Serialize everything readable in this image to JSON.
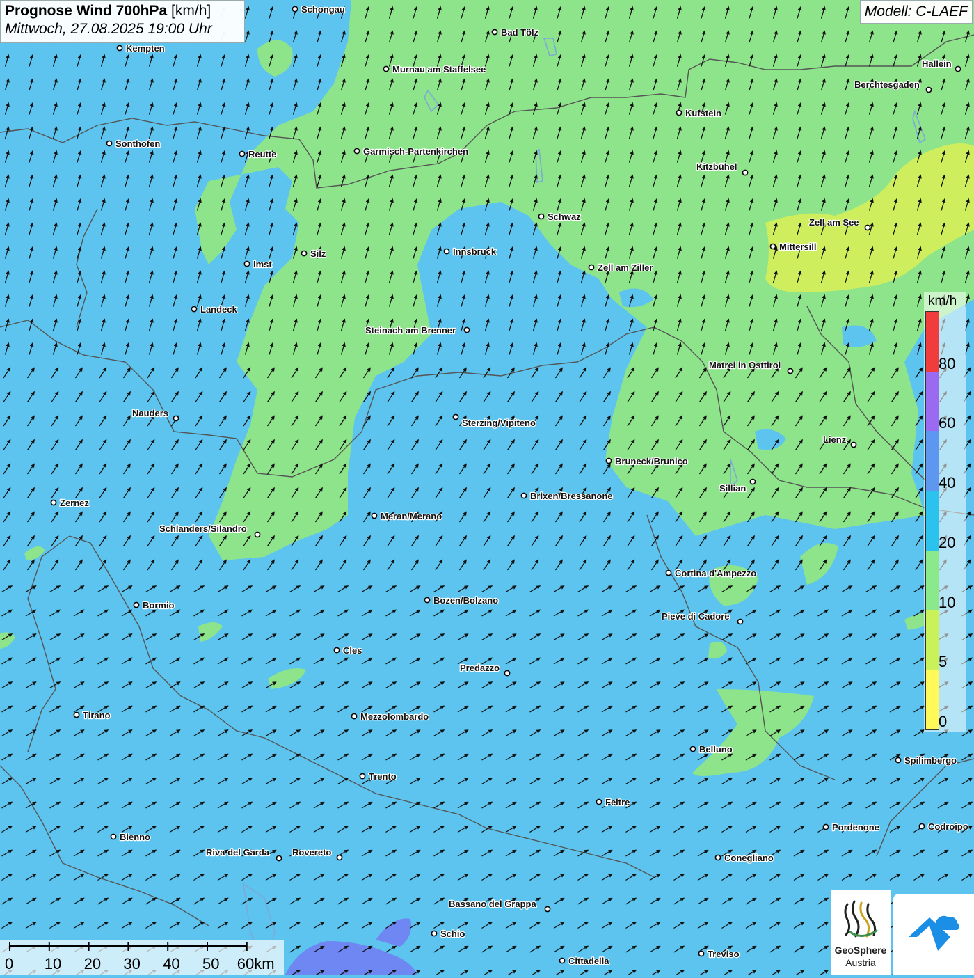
{
  "header": {
    "title_bold": "Prognose Wind 700hPa",
    "title_unit": " [km/h]",
    "datetime": "Mittwoch, 27.08.2025 19:00 Uhr",
    "model": "Modell: C-LAEF"
  },
  "legend": {
    "unit": "km/h",
    "ticks": [
      "0",
      "5",
      "10",
      "20",
      "40",
      "60",
      "80"
    ],
    "colors": [
      "#fff95a",
      "#c9f25a",
      "#8ae98a",
      "#2bc2ee",
      "#5e97f0",
      "#9a6bf0",
      "#f03c3c"
    ]
  },
  "colors": {
    "wind_fast": "#5cc4ee",
    "wind_medium": "#8ee48a",
    "wind_slow": "#cfee5e",
    "wind_purple": "#6f87f2",
    "border": "#555555",
    "lakes": "#7da9d8"
  },
  "scale": {
    "ticks": [
      "0",
      "10",
      "20",
      "30",
      "40",
      "50",
      "60km"
    ]
  },
  "logos": {
    "geosphere_name": "GeoSphere",
    "geosphere_sub": "Austria",
    "geosphere_icon": "geosphere-logo-icon",
    "app_icon": "weather-app-logo-icon"
  },
  "cities": [
    {
      "name": "Schongau",
      "dot": [
        424,
        13
      ],
      "label": [
        433,
        18
      ]
    },
    {
      "name": "Bad Tölz",
      "dot": [
        711,
        46
      ],
      "label": [
        720,
        51
      ]
    },
    {
      "name": "Kempten",
      "dot": [
        172,
        69
      ],
      "label": [
        181,
        74
      ]
    },
    {
      "name": "Murnau am Staffelsee",
      "dot": [
        555,
        99
      ],
      "label": [
        564,
        104
      ]
    },
    {
      "name": "Hallein",
      "dot": [
        1377,
        99
      ],
      "label": [
        1325,
        96
      ]
    },
    {
      "name": "Berchtesgaden",
      "dot": [
        1335,
        129
      ],
      "label": [
        1228,
        126
      ]
    },
    {
      "name": "Kufstein",
      "dot": [
        976,
        162
      ],
      "label": [
        985,
        167
      ]
    },
    {
      "name": "Sonthofen",
      "dot": [
        157,
        206
      ],
      "label": [
        166,
        211
      ]
    },
    {
      "name": "Garmisch-Partenkirchen",
      "dot": [
        513,
        217
      ],
      "label": [
        522,
        222
      ]
    },
    {
      "name": "Reutte",
      "dot": [
        348,
        221
      ],
      "label": [
        357,
        226
      ]
    },
    {
      "name": "Kitzbühel",
      "dot": [
        1071,
        248
      ],
      "label": [
        1001,
        244
      ]
    },
    {
      "name": "Schwaz",
      "dot": [
        778,
        311
      ],
      "label": [
        787,
        316
      ]
    },
    {
      "name": "Zell am See",
      "dot": [
        1247,
        327
      ],
      "label": [
        1163,
        324
      ]
    },
    {
      "name": "Mittersill",
      "dot": [
        1111,
        354
      ],
      "label": [
        1120,
        359
      ]
    },
    {
      "name": "Innsbruck",
      "dot": [
        642,
        361
      ],
      "label": [
        651,
        366
      ]
    },
    {
      "name": "Silz",
      "dot": [
        437,
        364
      ],
      "label": [
        446,
        369
      ]
    },
    {
      "name": "Imst",
      "dot": [
        355,
        379
      ],
      "label": [
        364,
        384
      ]
    },
    {
      "name": "Zell am Ziller",
      "dot": [
        850,
        384
      ],
      "label": [
        859,
        389
      ]
    },
    {
      "name": "Landeck",
      "dot": [
        279,
        444
      ],
      "label": [
        288,
        449
      ]
    },
    {
      "name": "Steinach am Brenner",
      "dot": [
        671,
        474
      ],
      "label": [
        525,
        479
      ]
    },
    {
      "name": "Matrei in Osttirol",
      "dot": [
        1136,
        533
      ],
      "label": [
        1019,
        529
      ]
    },
    {
      "name": "Nauders",
      "dot": [
        253,
        601
      ],
      "label": [
        190,
        598
      ]
    },
    {
      "name": "Sterzing/Vipiteno",
      "dot": [
        655,
        599
      ],
      "label": [
        664,
        612
      ]
    },
    {
      "name": "Lienz",
      "dot": [
        1227,
        639
      ],
      "label": [
        1183,
        636
      ]
    },
    {
      "name": "Bruneck/Brunico",
      "dot": [
        875,
        662
      ],
      "label": [
        884,
        667
      ]
    },
    {
      "name": "Sillian",
      "dot": [
        1082,
        692
      ],
      "label": [
        1034,
        706
      ]
    },
    {
      "name": "Brixen/Bressanone",
      "dot": [
        753,
        712
      ],
      "label": [
        762,
        717
      ]
    },
    {
      "name": "Zernez",
      "dot": [
        77,
        722
      ],
      "label": [
        86,
        727
      ]
    },
    {
      "name": "Meran/Merano",
      "dot": [
        538,
        741
      ],
      "label": [
        547,
        746
      ]
    },
    {
      "name": "Schlanders/Silandro",
      "dot": [
        370,
        768
      ],
      "label": [
        229,
        764
      ]
    },
    {
      "name": "Cortina d'Ampezzo",
      "dot": [
        961,
        823
      ],
      "label": [
        970,
        828
      ]
    },
    {
      "name": "Bozen/Bolzano",
      "dot": [
        614,
        862
      ],
      "label": [
        623,
        867
      ]
    },
    {
      "name": "Bormio",
      "dot": [
        196,
        869
      ],
      "label": [
        205,
        874
      ]
    },
    {
      "name": "Pieve di Cadore",
      "dot": [
        1064,
        893
      ],
      "label": [
        951,
        890
      ]
    },
    {
      "name": "Cles",
      "dot": [
        484,
        934
      ],
      "label": [
        493,
        939
      ]
    },
    {
      "name": "Predazzo",
      "dot": [
        729,
        967
      ],
      "label": [
        661,
        964
      ]
    },
    {
      "name": "Tirano",
      "dot": [
        110,
        1027
      ],
      "label": [
        119,
        1032
      ]
    },
    {
      "name": "Mezzolombardo",
      "dot": [
        509,
        1029
      ],
      "label": [
        518,
        1034
      ]
    },
    {
      "name": "Belluno",
      "dot": [
        996,
        1076
      ],
      "label": [
        1005,
        1081
      ]
    },
    {
      "name": "Spilimbergo",
      "dot": [
        1291,
        1092
      ],
      "label": [
        1300,
        1097
      ]
    },
    {
      "name": "Trento",
      "dot": [
        521,
        1115
      ],
      "label": [
        530,
        1120
      ]
    },
    {
      "name": "Feltre",
      "dot": [
        861,
        1152
      ],
      "label": [
        870,
        1157
      ]
    },
    {
      "name": "Pordenone",
      "dot": [
        1187,
        1188
      ],
      "label": [
        1196,
        1193
      ]
    },
    {
      "name": "Codroipo",
      "dot": [
        1325,
        1187
      ],
      "label": [
        1334,
        1192
      ]
    },
    {
      "name": "Bienno",
      "dot": [
        163,
        1202
      ],
      "label": [
        172,
        1207
      ]
    },
    {
      "name": "Riva del Garda",
      "dot": [
        401,
        1233
      ],
      "label": [
        296,
        1229
      ]
    },
    {
      "name": "Rovereto",
      "dot": [
        488,
        1232
      ],
      "label": [
        420,
        1229
      ]
    },
    {
      "name": "Conegliano",
      "dot": [
        1032,
        1232
      ],
      "label": [
        1041,
        1237
      ]
    },
    {
      "name": "Bassano del Grappa",
      "dot": [
        787,
        1306
      ],
      "label": [
        645,
        1303
      ]
    },
    {
      "name": "Schio",
      "dot": [
        624,
        1341
      ],
      "label": [
        633,
        1346
      ]
    },
    {
      "name": "Treviso",
      "dot": [
        1008,
        1370
      ],
      "label": [
        1017,
        1375
      ]
    },
    {
      "name": "Cittadella",
      "dot": [
        808,
        1380
      ],
      "label": [
        817,
        1385
      ]
    }
  ]
}
